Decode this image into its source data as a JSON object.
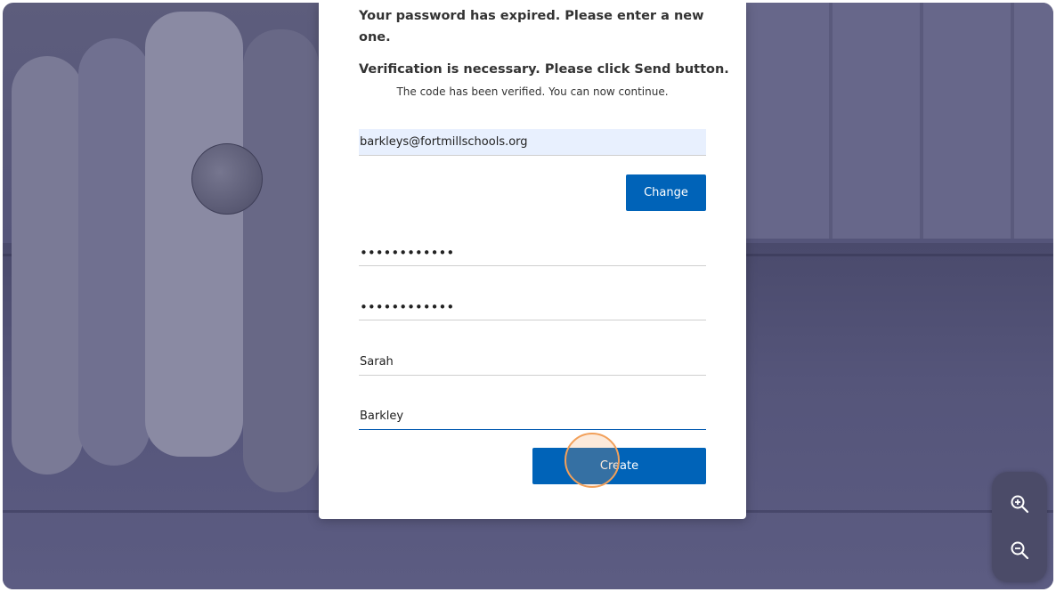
{
  "form": {
    "heading": "Your password has expired. Please enter a new one.",
    "verification_message": "Verification is necessary. Please click Send button.",
    "verified_message": "The code has been verified. You can now continue.",
    "email_value": "barkleys@fortmillschools.org",
    "change_label": "Change",
    "new_password_value": "••••••••••••",
    "confirm_password_value": "••••••••••••",
    "given_name_value": "Sarah",
    "surname_value": "Barkley",
    "create_label": "Create"
  },
  "zoom": {
    "zoom_in_icon": "zoom-in-icon",
    "zoom_out_icon": "zoom-out-icon"
  },
  "colors": {
    "primary_button": "#0063b8",
    "click_indicator": "#f2a05a",
    "overlay": "#54547a"
  }
}
